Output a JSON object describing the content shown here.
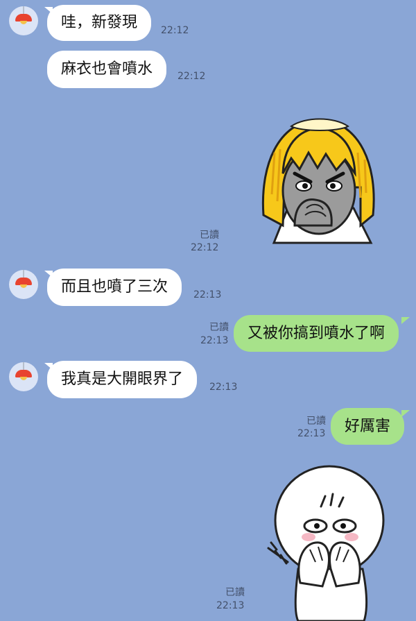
{
  "messages": [
    {
      "side": "in",
      "text": "哇，新發現",
      "time": "22:12"
    },
    {
      "side": "in",
      "text": "麻衣也會噴水",
      "time": "22:12"
    },
    {
      "side": "out-sticker",
      "sticker": "blonde-girl-covering-mouth-sticker",
      "read": "已讀",
      "time": "22:12"
    },
    {
      "side": "in",
      "text": "而且也噴了三次",
      "time": "22:13"
    },
    {
      "side": "out",
      "text": "又被你搞到噴水了啊",
      "read": "已讀",
      "time": "22:13"
    },
    {
      "side": "in",
      "text": "我真是大開眼界了",
      "time": "22:13"
    },
    {
      "side": "out",
      "text": "好厲害",
      "read": "已讀",
      "time": "22:13"
    },
    {
      "side": "out-sticker",
      "sticker": "white-face-covering-mouth-sticker",
      "read": "已讀",
      "time": "22:13"
    }
  ],
  "colors": {
    "background": "#8aa6d6",
    "incoming": "#ffffff",
    "outgoing": "#a7e28a"
  }
}
